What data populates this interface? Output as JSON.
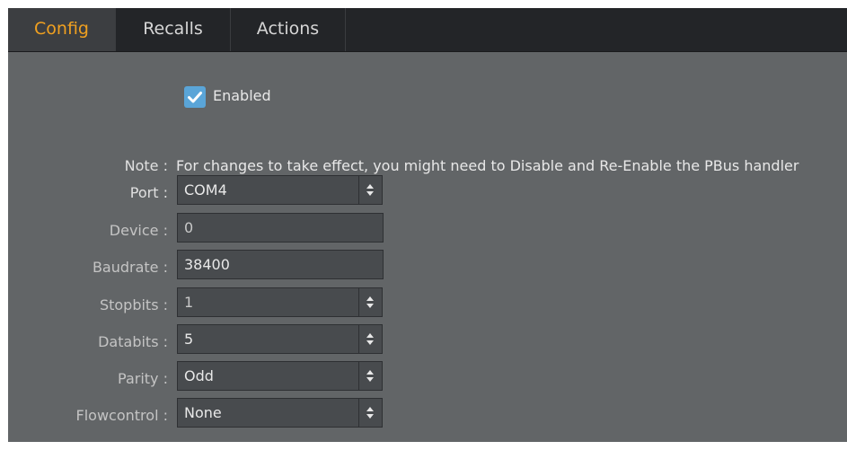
{
  "tabs": [
    {
      "label": "Config",
      "active": true
    },
    {
      "label": "Recalls",
      "active": false
    },
    {
      "label": "Actions",
      "active": false
    }
  ],
  "enabled": {
    "label": "Enabled",
    "checked": true
  },
  "note": {
    "label": "Note :",
    "text": "For changes to take effect, you might need to Disable and Re-Enable the PBus handler"
  },
  "fields": {
    "port": {
      "label": "Port :",
      "value": "COM4"
    },
    "device": {
      "label": "Device :",
      "value": "0"
    },
    "baudrate": {
      "label": "Baudrate :",
      "value": "38400"
    },
    "stopbits": {
      "label": "Stopbits :",
      "value": "1"
    },
    "databits": {
      "label": "Databits :",
      "value": "5"
    },
    "parity": {
      "label": "Parity :",
      "value": "Odd"
    },
    "flowcontrol": {
      "label": "Flowcontrol :",
      "value": "None"
    }
  },
  "colors": {
    "active_tab_text": "#f0a020",
    "checkbox": "#5aa5d8",
    "panel_bg": "#626567",
    "tabbar_bg": "#232528"
  }
}
